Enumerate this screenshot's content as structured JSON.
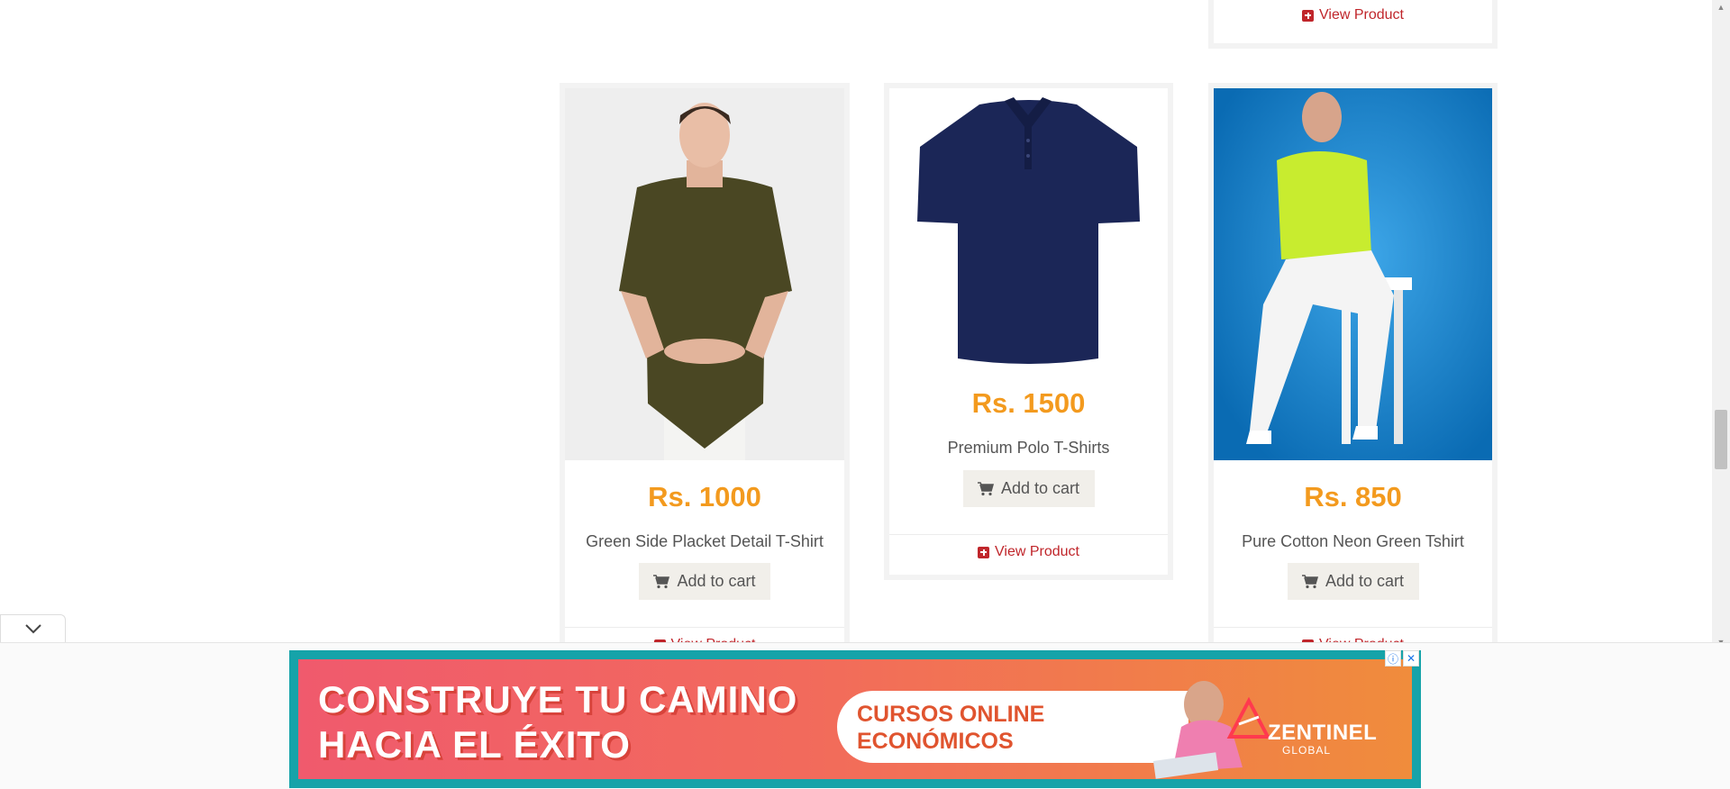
{
  "products": [
    {
      "price": "Rs. 1000",
      "name": "Green Side Placket Detail T-Shirt",
      "cart_label": "Add to cart",
      "view_label": "View Product",
      "image": "model-olive-shirt-photo"
    },
    {
      "price": "Rs. 1500",
      "name": "Premium Polo T-Shirts",
      "cart_label": "Add to cart",
      "view_label": "View Product",
      "image": "navy-polo-shirt-photo"
    },
    {
      "price": "Rs. 850",
      "name": "Pure Cotton Neon Green Tshirt",
      "cart_label": "Add to cart",
      "view_label": "View Product",
      "image": "model-neon-green-tshirt-photo"
    }
  ],
  "top_card": {
    "view_label": "View Product"
  },
  "ad": {
    "headline_1": "CONSTRUYE TU CAMINO",
    "headline_2": "HACIA EL ÉXITO",
    "sub_1": "CURSOS ONLINE",
    "sub_2": "ECONÓMICOS",
    "brand": "ZENTINEL",
    "brand_sub": "GLOBAL"
  },
  "colors": {
    "price": "#f39a1e",
    "link": "#c0262b",
    "ad_border": "#16a3a9"
  }
}
